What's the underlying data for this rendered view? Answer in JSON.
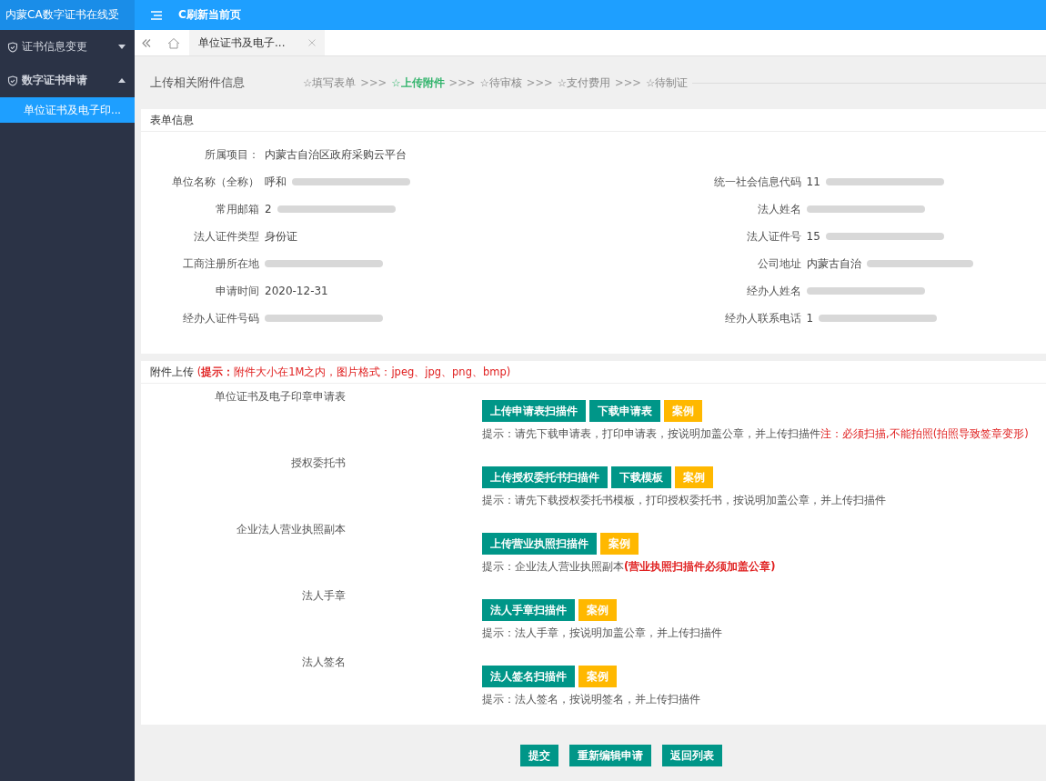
{
  "app_title": "内蒙CA数字证书在线受",
  "toolbar": {
    "refresh": "C刷新当前页"
  },
  "sidebar": {
    "items": [
      {
        "label": "证书信息变更",
        "expanded": false
      },
      {
        "label": "数字证书申请",
        "expanded": true,
        "children": [
          {
            "label": "单位证书及电子印...",
            "selected": true
          }
        ]
      }
    ]
  },
  "tabs": [
    {
      "label": "单位证书及电子...",
      "selected": true
    }
  ],
  "page_title": "上传相关附件信息",
  "steps": [
    {
      "label": "☆填写表单",
      "selected": false
    },
    {
      "label": "☆上传附件",
      "selected": true
    },
    {
      "label": "☆待审核",
      "selected": false
    },
    {
      "label": "☆支付费用",
      "selected": false
    },
    {
      "label": "☆待制证",
      "selected": false
    }
  ],
  "step_separator": ">>>",
  "form": {
    "title": "表单信息",
    "project": {
      "label": "所属项目：",
      "value": "内蒙古自治区政府采购云平台"
    },
    "rows": [
      [
        {
          "label": "单位名称（全称）",
          "value": "呼和",
          "redacted": true
        },
        {
          "label": "统一社会信息代码",
          "value": "11",
          "redacted": true
        }
      ],
      [
        {
          "label": "常用邮箱",
          "value": "2",
          "redacted": true
        },
        {
          "label": "法人姓名",
          "redacted": true
        }
      ],
      [
        {
          "label": "法人证件类型",
          "value": "身份证"
        },
        {
          "label": "法人证件号",
          "value": "15",
          "redacted": true
        }
      ],
      [
        {
          "label": "工商注册所在地",
          "redacted": true
        },
        {
          "label": "公司地址",
          "value": "内蒙古自治",
          "redacted": true
        }
      ],
      [
        {
          "label": "申请时间",
          "value": "2020-12-31"
        },
        {
          "label": "经办人姓名",
          "redacted": true
        }
      ],
      [
        {
          "label": "经办人证件号码",
          "redacted": true
        },
        {
          "label": "经办人联系电话",
          "value": "1",
          "redacted": true
        }
      ]
    ]
  },
  "attachments": {
    "title": "附件上传",
    "note": "(**提示：**附件大小在1M之内，图片格式：jpeg、jpg、png、bmp)",
    "items": [
      {
        "label": "单位证书及电子印章申请表",
        "buttons": [
          {
            "label": "上传申请表扫描件",
            "kind": "primary"
          },
          {
            "label": "下载申请表",
            "kind": "primary"
          },
          {
            "label": "案例",
            "kind": "example"
          }
        ],
        "hint": "提示：请先下载申请表，打印申请表，按说明加盖公章，并上传扫描件",
        "warning": "注：必须扫描,不能拍照(拍照导致签章变形)",
        "warning_bold": false
      },
      {
        "label": "授权委托书",
        "buttons": [
          {
            "label": "上传授权委托书扫描件",
            "kind": "primary"
          },
          {
            "label": "下载模板",
            "kind": "primary"
          },
          {
            "label": "案例",
            "kind": "example"
          }
        ],
        "hint": "提示：请先下载授权委托书模板，打印授权委托书，按说明加盖公章，并上传扫描件"
      },
      {
        "label": "企业法人营业执照副本",
        "buttons": [
          {
            "label": "上传营业执照扫描件",
            "kind": "primary"
          },
          {
            "label": "案例",
            "kind": "example"
          }
        ],
        "hint": "提示：企业法人营业执照副本",
        "warning": "(营业执照扫描件必须加盖公章)",
        "warning_bold": true
      },
      {
        "label": "法人手章",
        "buttons": [
          {
            "label": "法人手章扫描件",
            "kind": "primary"
          },
          {
            "label": "案例",
            "kind": "example"
          }
        ],
        "hint": "提示：法人手章，按说明加盖公章，并上传扫描件"
      },
      {
        "label": "法人签名",
        "buttons": [
          {
            "label": "法人签名扫描件",
            "kind": "primary"
          },
          {
            "label": "案例",
            "kind": "example"
          }
        ],
        "hint": "提示：法人签名，按说明签名，并上传扫描件"
      }
    ]
  },
  "footer_buttons": [
    "提交",
    "重新编辑申请",
    "返回列表"
  ]
}
